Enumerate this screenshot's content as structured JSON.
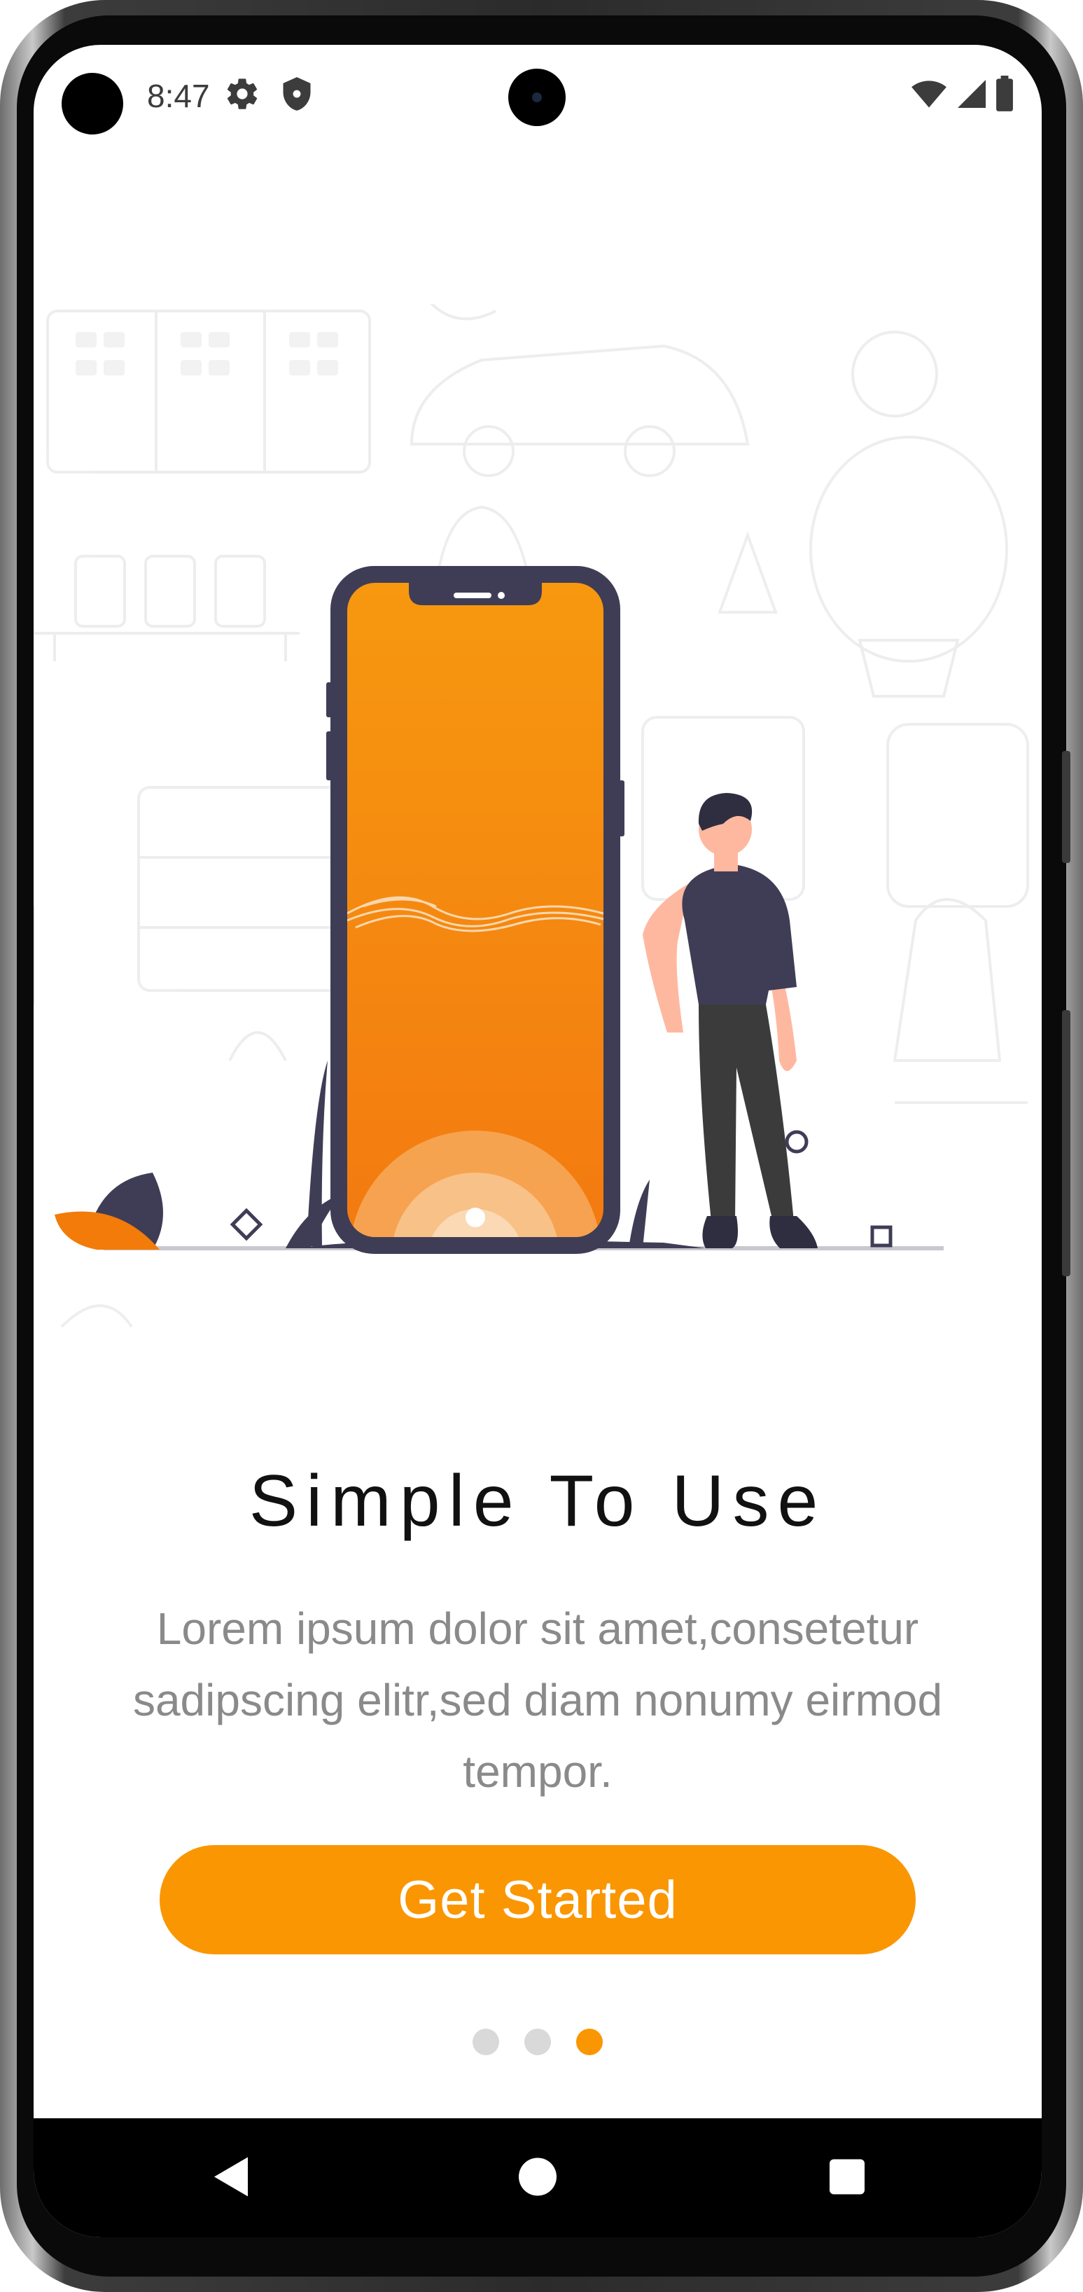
{
  "status_bar": {
    "time": "8:47",
    "icons": [
      "gear-icon",
      "shield-icon",
      "wifi-icon",
      "signal-icon",
      "battery-icon"
    ]
  },
  "onboarding": {
    "title": "Simple To Use",
    "description": "Lorem ipsum dolor sit amet,consetetur sadipscing elitr,sed diam nonumy eirmod tempor.",
    "cta_label": "Get Started",
    "page_count": 3,
    "active_page": 3
  },
  "navigation_bar": {
    "buttons": [
      "back-icon",
      "home-icon",
      "recents-icon"
    ]
  },
  "colors": {
    "accent": "#fa9601",
    "dot_inactive": "#d9d9d9",
    "title": "#111111",
    "description": "#8a8a8a",
    "illustration_dark": "#3f3d56"
  }
}
